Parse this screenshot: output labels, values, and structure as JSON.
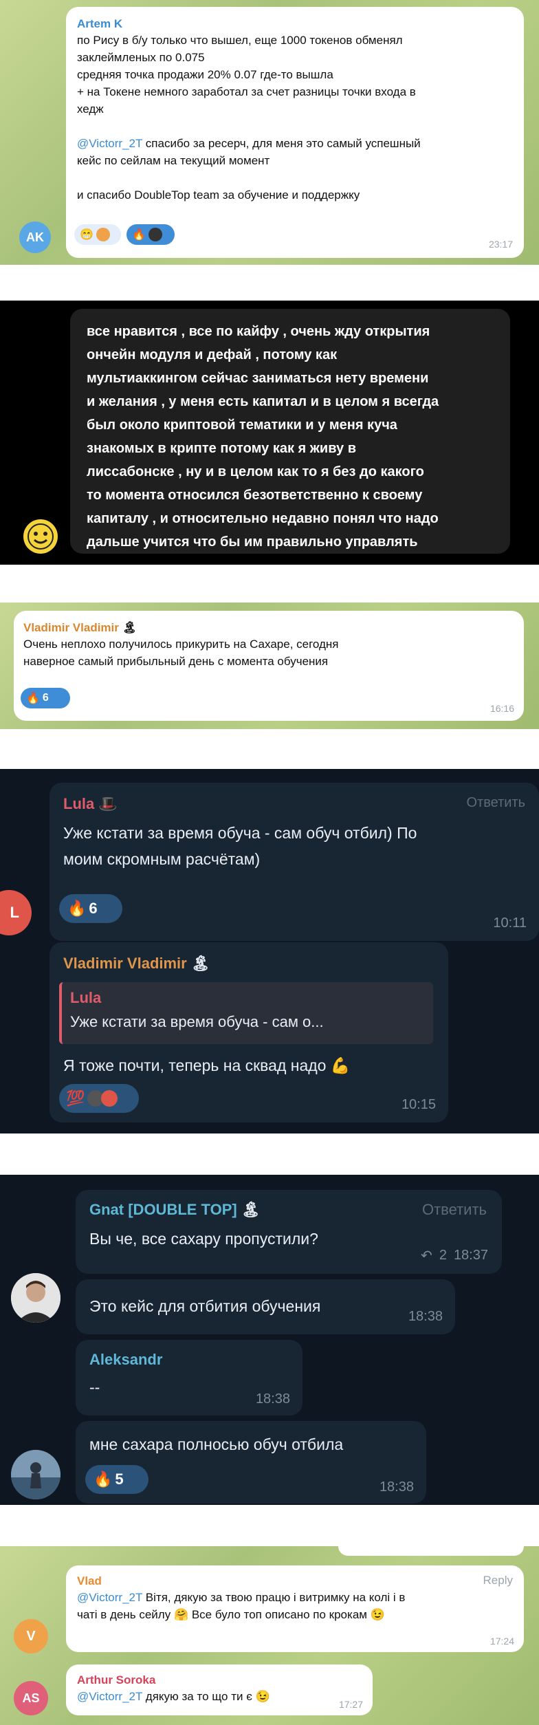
{
  "chat1": {
    "author": "Artem K",
    "avatar_initials": "AK",
    "text_lines": [
      "по Рису в б/у только что вышел, еще 1000 токенов обменял",
      "заклеймленых по 0.075",
      "средняя точка продажи 20% 0.07 где-то вышла",
      "+ на Токене немного заработал за счет разницы точки входа в",
      "хедж"
    ],
    "mention": "@Victorr_2T",
    "mention_text": " спасибо за ресерч, для меня это самый успешный",
    "mention_text2": "кейс по сейлам на текущий момент",
    "thanks": "и спасибо DoubleTop team за обучение и поддержку",
    "time": "23:17",
    "colors": {
      "author": "#3a8cd0",
      "avatar": "#5aa7e6"
    }
  },
  "chat2": {
    "text_lines": [
      "все нравится , все по кайфу , очень жду открытия",
      "ончейн модуля и дефай , потому как",
      "мультиаккингом сейчас заниматься нету времени",
      "и желания , у меня есть капитал и в целом я всегда",
      "был около криптовой тематики и у меня куча",
      "знакомых в крипте потому как я живу в",
      "лиссабонске , ну и в целом как то я без до какого",
      "то момента относился безответственно к своему",
      "капиталу , и относительно недавно понял что надо",
      "дальше учится что бы им правильно управлять"
    ]
  },
  "chat3": {
    "author": "Vladimir Vladimir",
    "author_emoji": "🏝",
    "line1": "Очень неплохо получилось прикурить на Сахаре, сегодня",
    "line2": "наверное самый прибыльный день с момента обучения",
    "reaction_emoji": "🔥",
    "reaction_count": "6",
    "time": "16:16",
    "colors": {
      "author": "#d9872e"
    }
  },
  "chat4": {
    "msg1": {
      "author": "Lula",
      "author_emoji": "🎩",
      "reply": "Ответить",
      "line1": "Уже кстати за время обуча - сам обуч отбил) По",
      "line2": "моим скромным расчётам)",
      "reaction_emoji": "🔥",
      "reaction_count": "6",
      "time": "10:11",
      "avatar_initial": "L"
    },
    "msg2": {
      "author": "Vladimir Vladimir",
      "author_emoji": "🏝",
      "quote_author": "Lula",
      "quote_text": "Уже кстати за время обуча - сам о...",
      "text": "Я тоже почти, теперь на сквад надо",
      "text_emoji": "💪",
      "reaction_emoji": "💯",
      "time": "10:15"
    },
    "colors": {
      "lula": "#e05c6b",
      "vladimir": "#e0964a",
      "avatar_l": "#e0554a"
    }
  },
  "chat5": {
    "msg1": {
      "author": "Gnat [DOUBLE TOP]",
      "author_emoji": "🏝",
      "reply": "Ответить",
      "text": "Вы че, все сахару пропустили?",
      "replies": "2",
      "time": "18:37"
    },
    "msg2": {
      "text": "Это кейс для отбития обучения",
      "time": "18:38"
    },
    "msg3": {
      "author": "Aleksandr",
      "text": "--",
      "time": "18:38"
    },
    "msg4": {
      "text": "мне сахара полносью обуч отбила",
      "reaction_emoji": "🔥",
      "reaction_count": "5",
      "time": "18:38"
    },
    "colors": {
      "author": "#5fb8d6"
    }
  },
  "chat6": {
    "msg1": {
      "author": "Vlad",
      "reply": "Reply",
      "mention": "@Victorr_2T",
      "line1": " Вітя, дякую за твою працю і витримку на колі і в",
      "line2": "чаті в день сейлу",
      "emoji1": "🤗",
      "line2b": " Все було топ описано по крокам",
      "emoji2": "😉",
      "time": "17:24",
      "avatar_initial": "V"
    },
    "msg2": {
      "author": "Arthur Soroka",
      "mention": "@Victorr_2T",
      "text": " дякую за то що ти є",
      "emoji": "😉",
      "time": "17:27",
      "avatar_initials": "AS"
    },
    "colors": {
      "vlad": "#e88a2e",
      "arthur": "#d5435b",
      "avatar_v": "#f0a24a",
      "avatar_as": "#e0607a"
    }
  }
}
